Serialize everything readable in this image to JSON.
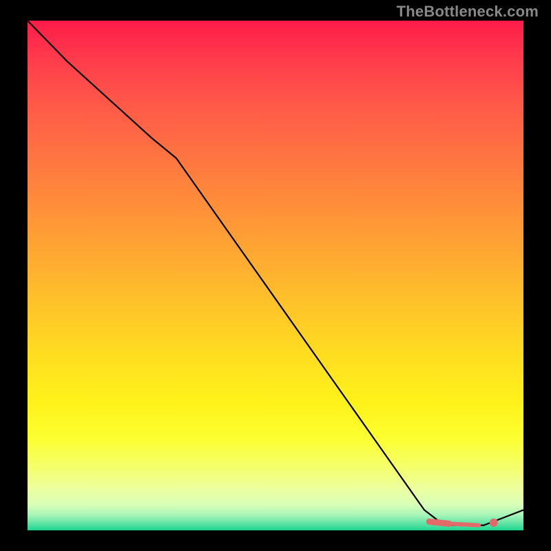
{
  "attribution": "TheBottleneck.com",
  "chart_data": {
    "type": "line",
    "title": "",
    "xlabel": "",
    "ylabel": "",
    "xlim": [
      0,
      100
    ],
    "ylim": [
      0,
      100
    ],
    "grid": false,
    "legend": false,
    "series": [
      {
        "name": "bottleneck-curve",
        "x": [
          0,
          8,
          25,
          30,
          80,
          84,
          92,
          100
        ],
        "y": [
          100,
          92,
          77,
          73,
          4,
          1,
          1,
          4
        ]
      }
    ],
    "markers": [
      {
        "name": "flat-region-thick",
        "x": [
          81,
          85
        ],
        "y": [
          1.7,
          1.3
        ]
      },
      {
        "name": "flat-region-thin",
        "x": [
          85,
          91
        ],
        "y": [
          1.3,
          1.0
        ]
      },
      {
        "name": "end-dot",
        "x": 94,
        "y": 1.5
      }
    ],
    "background_gradient": {
      "from": "#ff1c4a",
      "through": [
        "#ff9338",
        "#fff21a",
        "#ecffa0"
      ],
      "to": "#1cd690"
    }
  }
}
